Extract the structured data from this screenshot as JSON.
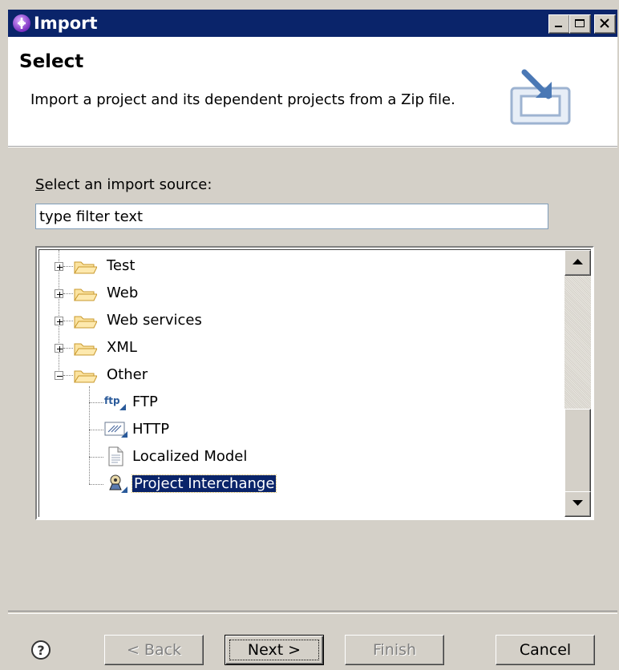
{
  "window": {
    "title": "Import",
    "controls": [
      "minimize-icon",
      "maximize-icon",
      "close-icon"
    ]
  },
  "header": {
    "title": "Select",
    "description": "Import a project and its dependent projects from a Zip file.",
    "image": "import-banner-icon"
  },
  "source": {
    "label": "Select an import source:",
    "filter_value": "type filter text"
  },
  "tree": {
    "items": [
      {
        "label": "Test",
        "icon": "folder-icon",
        "expander": "+"
      },
      {
        "label": "Web",
        "icon": "folder-icon",
        "expander": "+"
      },
      {
        "label": "Web services",
        "icon": "folder-icon",
        "expander": "+"
      },
      {
        "label": "XML",
        "icon": "folder-icon",
        "expander": "+"
      },
      {
        "label": "Other",
        "icon": "folder-open-icon",
        "expander": "-"
      }
    ],
    "children": [
      {
        "label": "FTP",
        "icon": "ftp-icon"
      },
      {
        "label": "HTTP",
        "icon": "http-icon"
      },
      {
        "label": "Localized Model",
        "icon": "document-icon"
      },
      {
        "label": "Project Interchange",
        "icon": "project-interchange-icon",
        "selected": true
      }
    ]
  },
  "footer": {
    "help_icon": "help-icon",
    "back": "< Back",
    "next": "Next >",
    "finish": "Finish",
    "cancel": "Cancel"
  },
  "colors": {
    "titlebar": "#0a246a",
    "selection": "#0a246a",
    "dialog": "#d4d0c8"
  }
}
